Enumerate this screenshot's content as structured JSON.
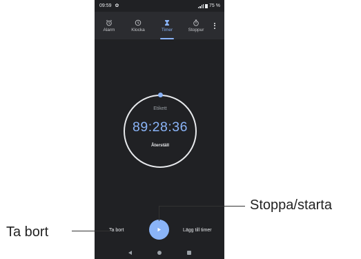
{
  "status_bar": {
    "time": "09:59",
    "battery": "75 %"
  },
  "tabs": [
    {
      "label": "Alarm",
      "icon": "alarm-icon",
      "active": false
    },
    {
      "label": "Klocka",
      "icon": "clock-icon",
      "active": false
    },
    {
      "label": "Timer",
      "icon": "hourglass-icon",
      "active": true
    },
    {
      "label": "Stoppur",
      "icon": "stopwatch-icon",
      "active": false
    }
  ],
  "timer": {
    "label": "Etikett",
    "time": "89:28:36",
    "reset_label": "Återställ"
  },
  "actions": {
    "delete_label": "Ta bort",
    "add_label": "Lägg till timer",
    "play_icon": "play-icon"
  },
  "annotations": {
    "delete": "Ta bort",
    "start_stop": "Stoppa/starta"
  },
  "colors": {
    "accent": "#8ab4f8",
    "background": "#202124",
    "tabbar": "#2b2c30"
  }
}
